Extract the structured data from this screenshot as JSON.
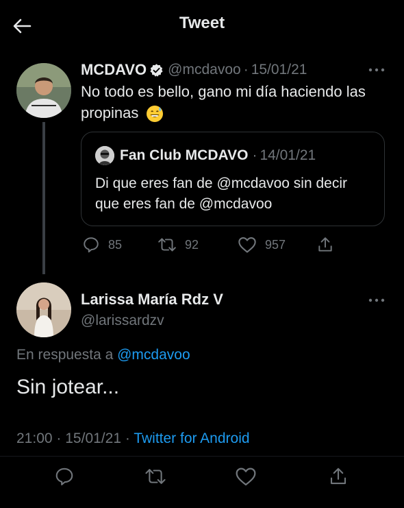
{
  "header": {
    "title": "Tweet"
  },
  "tweet": {
    "author_name": "MCDAVO",
    "handle": "@mcdavoo",
    "date": "15/01/21",
    "text": "No todo es bello, gano mi día haciendo las propinas",
    "quote": {
      "author_name": "Fan Club MCDAVO",
      "date": "14/01/21",
      "text": "Di que eres fan de @mcdavoo sin decir que eres fan de @mcdavoo"
    },
    "actions": {
      "replies": "85",
      "retweets": "92",
      "likes": "957"
    }
  },
  "reply": {
    "author_name": "Larissa María Rdz V",
    "handle": "@larissardzv",
    "reply_prefix": "En respuesta a",
    "reply_to": "@mcdavoo",
    "text": "Sin jotear...",
    "time": "21:00",
    "date": "15/01/21",
    "source": "Twitter for Android"
  },
  "colors": {
    "background": "#000000",
    "text_primary": "#e7e9ea",
    "text_secondary": "#71767b",
    "accent": "#1d9bf0",
    "border": "#2f3336"
  },
  "icons": [
    "back-arrow-icon",
    "verified-badge-icon",
    "more-icon",
    "reply-icon",
    "retweet-icon",
    "like-icon",
    "share-icon"
  ]
}
